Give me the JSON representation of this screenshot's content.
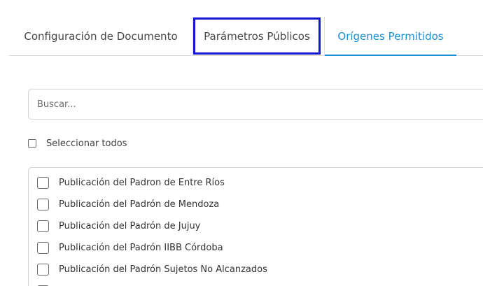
{
  "tabs": [
    {
      "label": "Configuración de Documento",
      "active": false
    },
    {
      "label": "Parámetros Públicos",
      "highlighted": true
    },
    {
      "label": "Orígenes Permitidos",
      "active": true
    }
  ],
  "colors": {
    "accent": "#1a8fd6",
    "highlight_box": "#1414d6",
    "border": "#d3d3d3"
  },
  "search": {
    "placeholder": "Buscar...",
    "value": ""
  },
  "select_all": {
    "label": "Seleccionar todos",
    "checked": false
  },
  "items": [
    {
      "label": "Publicación del Padron de Entre Ríos",
      "checked": false
    },
    {
      "label": "Publicación del Padrón de Mendoza",
      "checked": false
    },
    {
      "label": "Publicación del Padrón de Jujuy",
      "checked": false
    },
    {
      "label": "Publicación del Padrón IIBB Córdoba",
      "checked": false
    },
    {
      "label": "Publicación del Padrón Sujetos No Alcanzados",
      "checked": false
    },
    {
      "label": "",
      "checked": false
    }
  ]
}
